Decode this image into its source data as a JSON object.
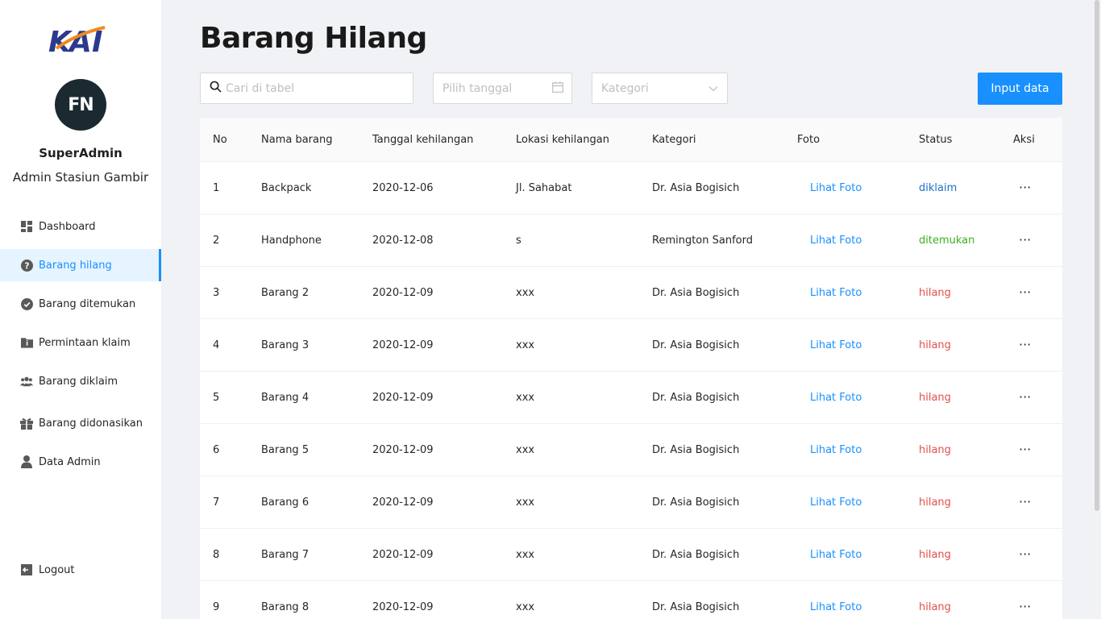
{
  "sidebar": {
    "logo_text": "KAI",
    "avatar_initials": "FN",
    "user_name": "SuperAdmin",
    "user_role": "Admin Stasiun Gambir",
    "items": [
      {
        "label": "Dashboard",
        "icon": "dashboard-icon"
      },
      {
        "label": "Barang hilang",
        "icon": "question-circle-icon",
        "active": true
      },
      {
        "label": "Barang ditemukan",
        "icon": "check-circle-icon"
      },
      {
        "label": "Permintaan klaim",
        "icon": "folder-info-icon"
      },
      {
        "label": "Barang diklaim",
        "icon": "team-icon"
      },
      {
        "label": "Barang didonasikan",
        "icon": "gift-icon"
      },
      {
        "label": "Data Admin",
        "icon": "user-icon"
      }
    ],
    "logout_label": "Logout"
  },
  "header": {
    "title": "Barang Hilang"
  },
  "filters": {
    "search_placeholder": "Cari di tabel",
    "date_placeholder": "Pilih tanggal",
    "category_placeholder": "Kategori",
    "input_button": "Input data"
  },
  "table": {
    "columns": [
      "No",
      "Nama barang",
      "Tanggal kehilangan",
      "Lokasi kehilangan",
      "Kategori",
      "Foto",
      "Status",
      "Aksi"
    ],
    "rows": [
      {
        "no": "1",
        "nama": "Backpack",
        "tanggal": "2020-12-06",
        "lokasi": "Jl. Sahabat",
        "kategori": "Dr. Asia Bogisich",
        "foto": "Lihat Foto",
        "status": "diklaim",
        "aksi": "···"
      },
      {
        "no": "2",
        "nama": "Handphone",
        "tanggal": "2020-12-08",
        "lokasi": "s",
        "kategori": "Remington Sanford",
        "foto": "Lihat Foto",
        "status": "ditemukan",
        "aksi": "···"
      },
      {
        "no": "3",
        "nama": "Barang 2",
        "tanggal": "2020-12-09",
        "lokasi": "xxx",
        "kategori": "Dr. Asia Bogisich",
        "foto": "Lihat Foto",
        "status": "hilang",
        "aksi": "···"
      },
      {
        "no": "4",
        "nama": "Barang 3",
        "tanggal": "2020-12-09",
        "lokasi": "xxx",
        "kategori": "Dr. Asia Bogisich",
        "foto": "Lihat Foto",
        "status": "hilang",
        "aksi": "···"
      },
      {
        "no": "5",
        "nama": "Barang 4",
        "tanggal": "2020-12-09",
        "lokasi": "xxx",
        "kategori": "Dr. Asia Bogisich",
        "foto": "Lihat Foto",
        "status": "hilang",
        "aksi": "···"
      },
      {
        "no": "6",
        "nama": "Barang 5",
        "tanggal": "2020-12-09",
        "lokasi": "xxx",
        "kategori": "Dr. Asia Bogisich",
        "foto": "Lihat Foto",
        "status": "hilang",
        "aksi": "···"
      },
      {
        "no": "7",
        "nama": "Barang 6",
        "tanggal": "2020-12-09",
        "lokasi": "xxx",
        "kategori": "Dr. Asia Bogisich",
        "foto": "Lihat Foto",
        "status": "hilang",
        "aksi": "···"
      },
      {
        "no": "8",
        "nama": "Barang 7",
        "tanggal": "2020-12-09",
        "lokasi": "xxx",
        "kategori": "Dr. Asia Bogisich",
        "foto": "Lihat Foto",
        "status": "hilang",
        "aksi": "···"
      },
      {
        "no": "9",
        "nama": "Barang 8",
        "tanggal": "2020-12-09",
        "lokasi": "xxx",
        "kategori": "Dr. Asia Bogisich",
        "foto": "Lihat Foto",
        "status": "hilang",
        "aksi": "···"
      }
    ]
  },
  "colors": {
    "accent": "#1890ff",
    "status_diklaim": "#1d6fc5",
    "status_ditemukan": "#3db01f",
    "status_hilang": "#e0504a"
  }
}
